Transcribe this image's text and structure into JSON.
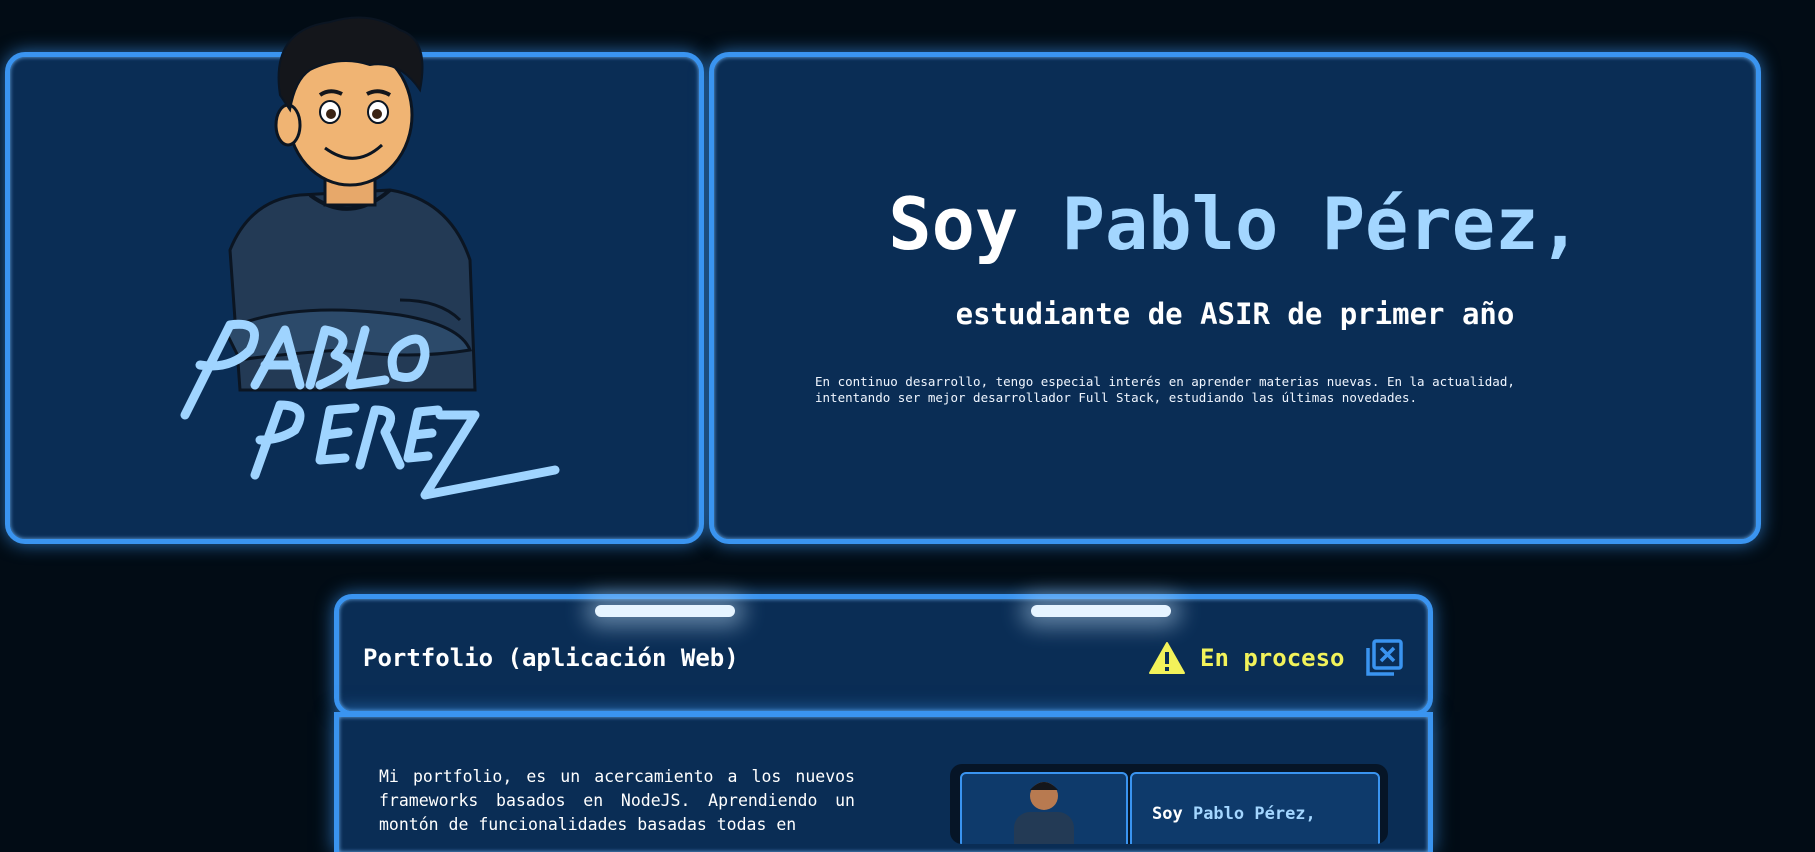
{
  "hero": {
    "heading_prefix": "Soy ",
    "heading_name": "Pablo Pérez,",
    "subtitle": "estudiante de ASIR de primer año",
    "description": "En continuo desarrollo, tengo especial interés en aprender materias nuevas. En la actualidad, intentando ser mejor desarrollador Full Stack, estudiando las últimas novedades.",
    "signature_text": "PABLO PÉREZ"
  },
  "project": {
    "title": "Portfolio (aplicación Web)",
    "status": "En proceso",
    "status_icon": "warning-triangle-icon",
    "close_icon": "close-square-icon",
    "description": "Mi portfolio, es un acercamiento a los nuevos frameworks basados en NodeJS. Aprendiendo un montón de funcionalidades basadas todas en",
    "preview": {
      "heading_prefix": "Soy ",
      "heading_name": "Pablo Pérez,"
    }
  },
  "colors": {
    "background": "#020c15",
    "panel": "#0a2d55",
    "border": "#3a94f0",
    "accent": "#a3d6ff",
    "status": "#f2f25a"
  }
}
